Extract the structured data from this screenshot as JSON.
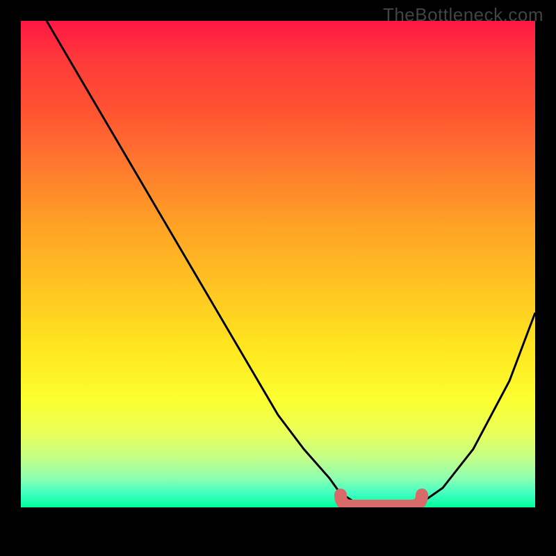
{
  "watermark": "TheBottleneck.com",
  "chart_data": {
    "type": "line",
    "title": "",
    "xlabel": "",
    "ylabel": "",
    "xlim": [
      0,
      100
    ],
    "ylim": [
      0,
      100
    ],
    "grid": false,
    "legend": false,
    "series": [
      {
        "name": "bottleneck-curve",
        "x": [
          5,
          10,
          15,
          20,
          25,
          30,
          35,
          40,
          45,
          50,
          55,
          60,
          62,
          65,
          68,
          72,
          75,
          78,
          82,
          88,
          95,
          100
        ],
        "y": [
          100,
          91,
          82,
          73,
          64,
          55,
          46,
          37,
          28,
          19,
          12,
          6,
          3,
          1,
          0,
          0,
          0,
          1,
          4,
          12,
          26,
          40
        ]
      }
    ],
    "highlight": {
      "name": "optimal-zone",
      "x_range": [
        62,
        78
      ],
      "y": 0,
      "color": "#d86a6a"
    },
    "colors": {
      "gradient_top": "#ff1744",
      "gradient_mid": "#ffe81f",
      "gradient_bottom": "#00ff9c",
      "curve": "#000000",
      "highlight": "#d86a6a",
      "frame": "#000000"
    }
  }
}
